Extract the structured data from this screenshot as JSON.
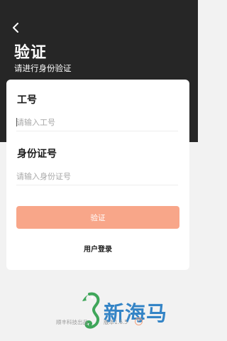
{
  "header": {
    "title": "验证",
    "subtitle": "请进行身份验证"
  },
  "form": {
    "employee_id": {
      "label": "工号",
      "placeholder": "请输入工号",
      "value": ""
    },
    "id_number": {
      "label": "身份证号",
      "placeholder": "请输入身份证号",
      "value": ""
    },
    "submit_label": "验证",
    "login_link": "用户登录"
  },
  "footer": {
    "company": "顺丰科技出品",
    "version": "版本1.6.5",
    "help_symbol": "?"
  },
  "watermark": {
    "text": "新海马"
  },
  "colors": {
    "header_bg": "#262626",
    "accent": "#f8a689",
    "page_bg": "#f2f2f2",
    "watermark_blue": "#2a7fc4",
    "watermark_green": "#3fa65a"
  },
  "icons": {
    "back": "chevron-left-icon",
    "help": "question-circle-icon",
    "logo": "seahorse-logo-icon"
  }
}
